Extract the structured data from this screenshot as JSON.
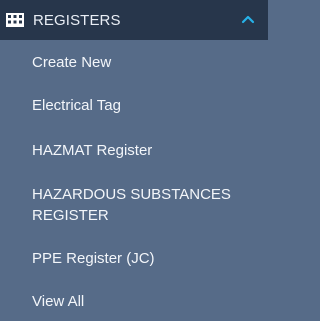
{
  "header": {
    "title": "REGISTERS",
    "icon": "register-grid-icon",
    "chevron_icon": "chevron-up-icon",
    "accent_color": "#26b2e8"
  },
  "items": [
    {
      "label": "Create New"
    },
    {
      "label": "Electrical Tag"
    },
    {
      "label": "HAZMAT Register"
    },
    {
      "label": "HAZARDOUS SUBSTANCES REGISTER"
    },
    {
      "label": "PPE Register (JC)"
    },
    {
      "label": "View All"
    }
  ]
}
